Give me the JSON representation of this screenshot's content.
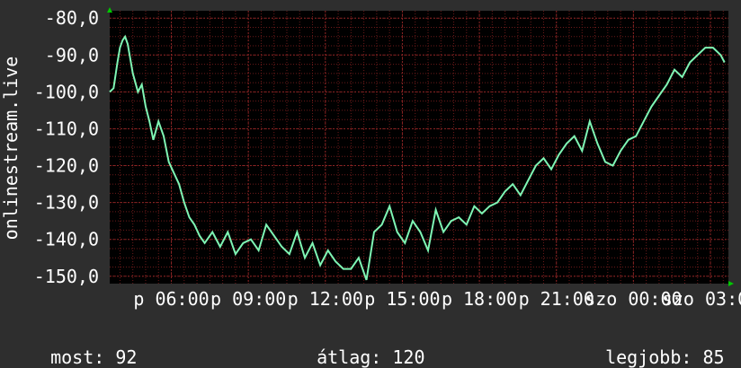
{
  "chart_data": {
    "type": "line",
    "ylabel": "onlinestream.live",
    "yticks": [
      "-80,0",
      "-90,0",
      "-100,0",
      "-110,0",
      "-120,0",
      "-130,0",
      "-140,0",
      "-150,0"
    ],
    "ytick_values": [
      -80,
      -90,
      -100,
      -110,
      -120,
      -130,
      -140,
      -150
    ],
    "ylim": [
      -152,
      -78
    ],
    "xlim": [
      3.6,
      27.7
    ],
    "xticks": [
      "p 06:00",
      "p 09:00",
      "p 12:00",
      "p 15:00",
      "p 18:00",
      "p 21:00",
      "szo 00:00",
      "szo 03:00"
    ],
    "xtick_values": [
      6,
      9,
      12,
      15,
      18,
      21,
      24,
      27
    ],
    "grid": true,
    "colors": {
      "line": "#7ff5b4",
      "background": "#000000",
      "grid": "#6b1a1a",
      "frame": "#2e2e2e",
      "axis_arrow": "#00c800"
    },
    "series": [
      {
        "x": [
          3.6,
          3.75,
          3.9,
          4.0,
          4.1,
          4.2,
          4.3,
          4.5,
          4.7,
          4.85,
          5.0,
          5.15,
          5.3,
          5.5,
          5.7,
          5.9,
          6.1,
          6.3,
          6.5,
          6.7,
          6.9,
          7.1,
          7.3,
          7.6,
          7.9,
          8.2,
          8.5,
          8.8,
          9.1,
          9.4,
          9.7,
          10.0,
          10.3,
          10.6,
          10.9,
          11.2,
          11.5,
          11.8,
          12.1,
          12.4,
          12.7,
          13.0,
          13.3,
          13.6,
          13.9,
          14.2,
          14.5,
          14.8,
          15.1,
          15.4,
          15.7,
          16.0,
          16.3,
          16.6,
          16.9,
          17.2,
          17.5,
          17.8,
          18.1,
          18.4,
          18.7,
          19.0,
          19.3,
          19.6,
          19.9,
          20.2,
          20.5,
          20.8,
          21.1,
          21.4,
          21.7,
          22.0,
          22.3,
          22.6,
          22.9,
          23.2,
          23.5,
          23.8,
          24.1,
          24.4,
          24.7,
          25.0,
          25.3,
          25.6,
          25.9,
          26.2,
          26.5,
          26.8,
          27.1,
          27.4,
          27.55
        ],
        "y": [
          -100,
          -99,
          -92,
          -88,
          -86,
          -85,
          -87,
          -95,
          -100,
          -98,
          -104,
          -108,
          -113,
          -108,
          -112,
          -119,
          -122,
          -125,
          -130,
          -134,
          -136,
          -139,
          -141,
          -138,
          -142,
          -138,
          -144,
          -141,
          -140,
          -143,
          -136,
          -139,
          -142,
          -144,
          -138,
          -145,
          -141,
          -147,
          -143,
          -146,
          -148,
          -148,
          -145,
          -151,
          -138,
          -136,
          -131,
          -138,
          -141,
          -135,
          -138,
          -143,
          -132,
          -138,
          -135,
          -134,
          -136,
          -131,
          -133,
          -131,
          -130,
          -127,
          -125,
          -128,
          -124,
          -120,
          -118,
          -121,
          -117,
          -114,
          -112,
          -116,
          -108,
          -114,
          -119,
          -120,
          -116,
          -113,
          -112,
          -108,
          -104,
          -101,
          -98,
          -94,
          -96,
          -92,
          -90,
          -88,
          -88,
          -90,
          -92
        ]
      }
    ],
    "stats": {
      "now_label": "most:",
      "now_value": "92",
      "avg_label": "átlag:",
      "avg_value": "120",
      "best_label": "legjobb:",
      "best_value": "85"
    }
  }
}
